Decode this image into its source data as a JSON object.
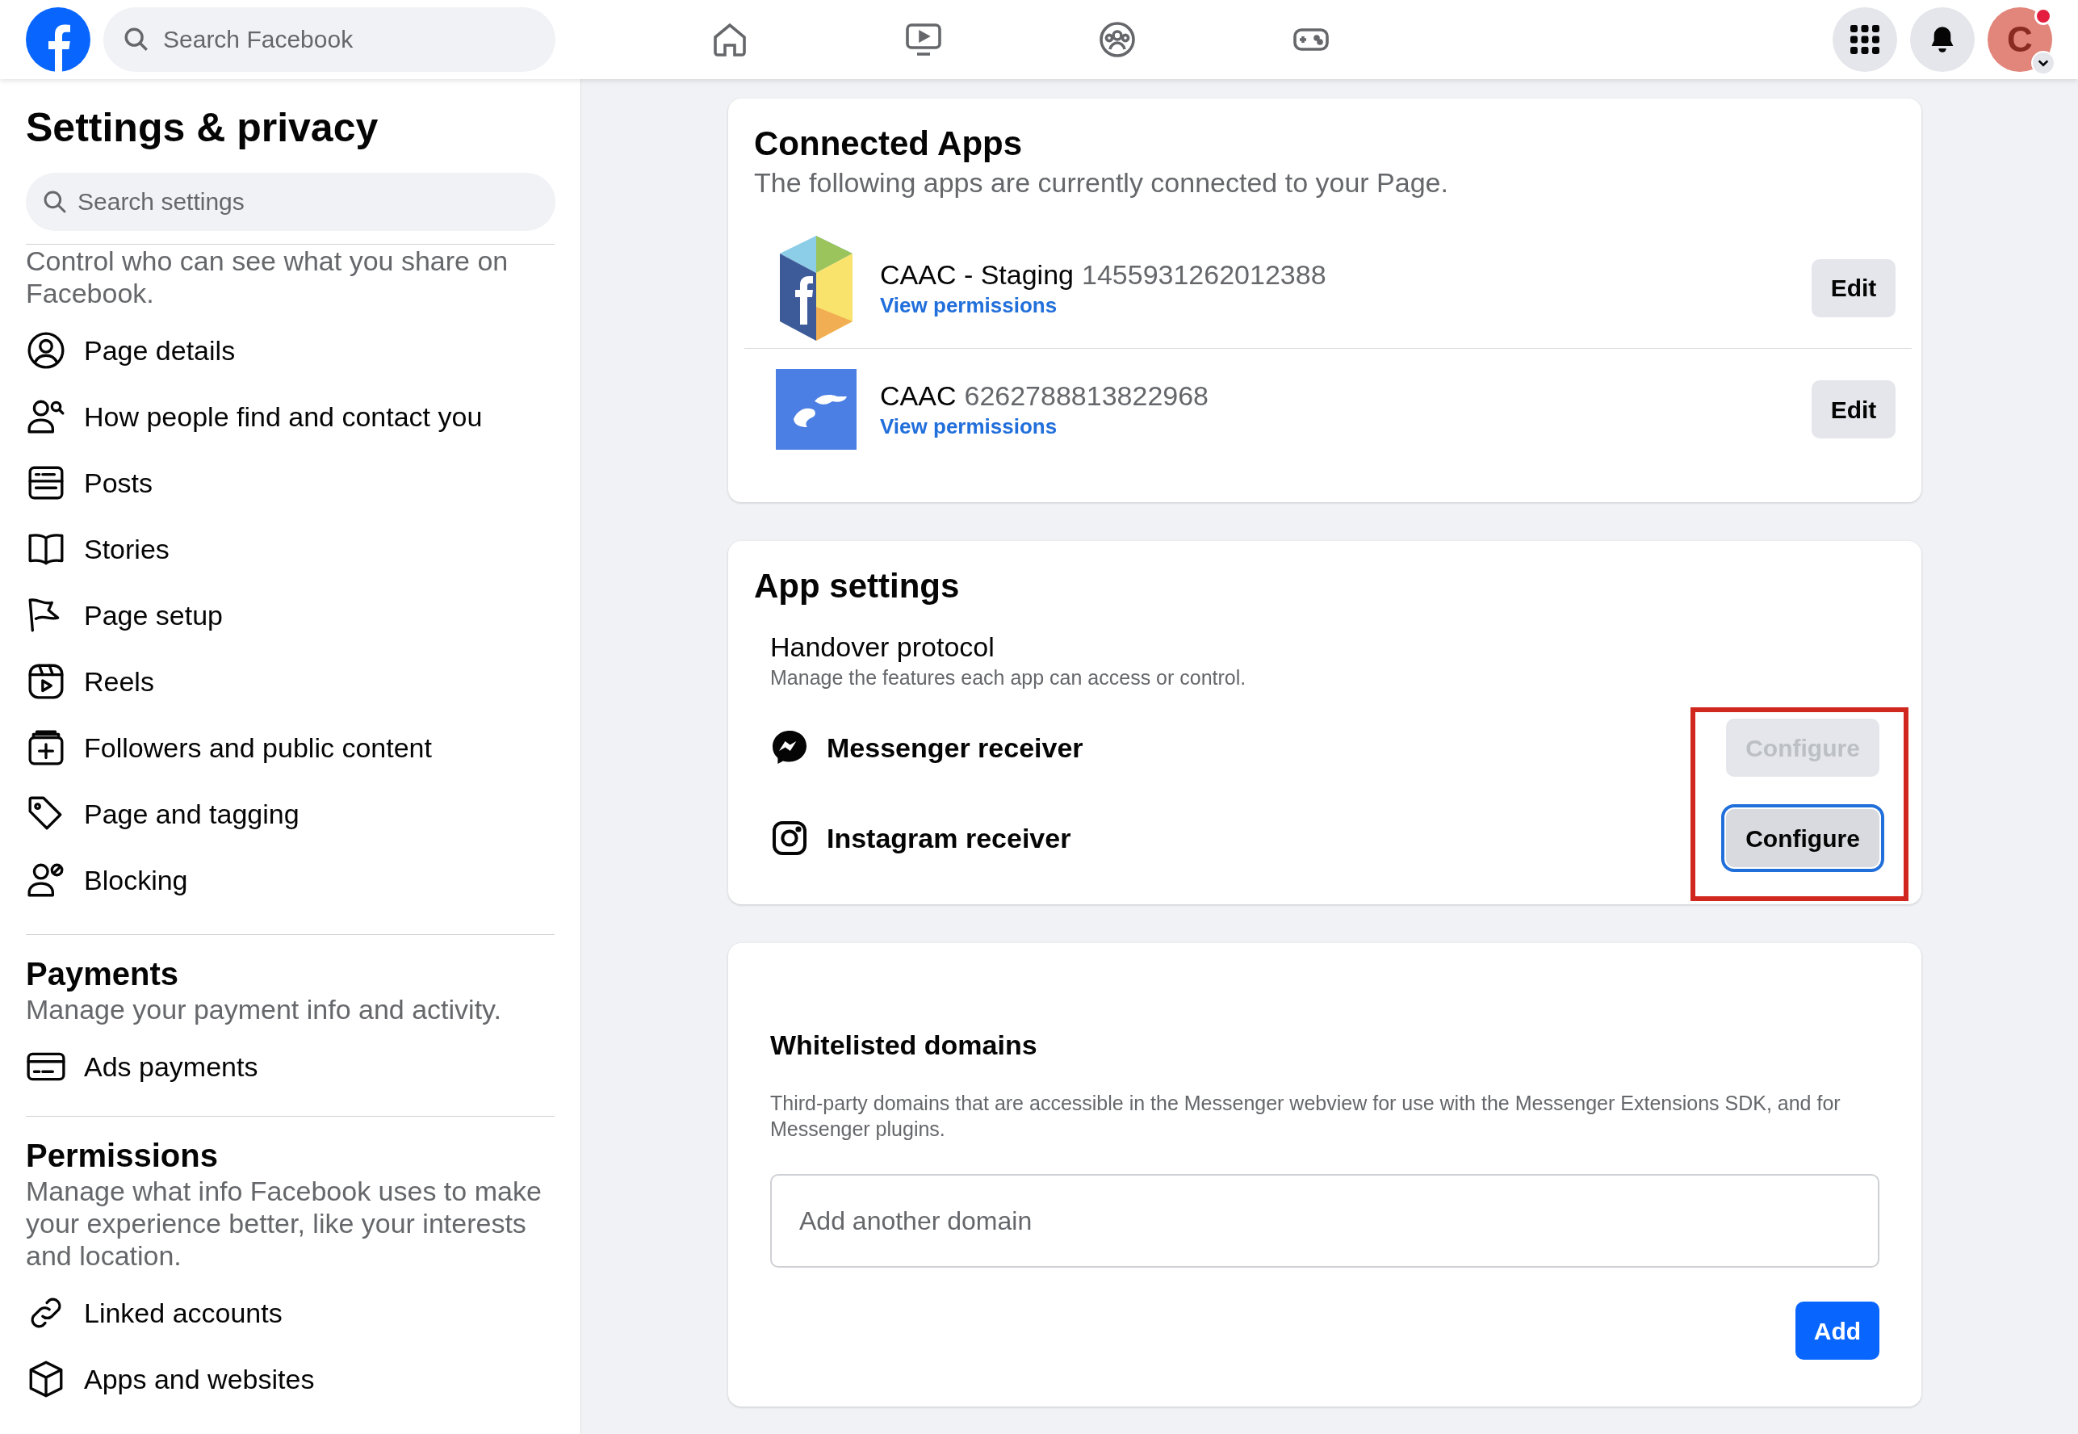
{
  "top_bar": {
    "search": {
      "placeholder": "Search Facebook"
    },
    "account": {
      "avatar_letter": "C",
      "has_notification": true
    }
  },
  "sidebar": {
    "title": "Settings & privacy",
    "search": {
      "placeholder": "Search settings"
    },
    "sections": [
      {
        "description": "Control who can see what you share on Facebook.",
        "items": [
          "Page details",
          "How people find and contact you",
          "Posts",
          "Stories",
          "Page setup",
          "Reels",
          "Followers and public content",
          "Page and tagging",
          "Blocking"
        ]
      },
      {
        "heading": "Payments",
        "description": "Manage your payment info and activity.",
        "items": [
          "Ads payments"
        ]
      },
      {
        "heading": "Permissions",
        "description": "Manage what info Facebook uses to make your experience better, like your interests and location.",
        "items": [
          "Linked accounts",
          "Apps and websites"
        ]
      }
    ]
  },
  "connected_apps": {
    "title": "Connected Apps",
    "subtitle": "The following apps are currently connected to your Page.",
    "apps": [
      {
        "name": "CAAC - Staging",
        "id": "1455931262012388",
        "link": "View permissions",
        "button": "Edit"
      },
      {
        "name": "CAAC",
        "id": "6262788813822968",
        "link": "View permissions",
        "button": "Edit"
      }
    ]
  },
  "app_settings": {
    "title": "App settings",
    "section_title": "Handover protocol",
    "section_description": "Manage the features each app can access or control.",
    "receivers": [
      {
        "label": "Messenger receiver",
        "button": "Configure",
        "disabled": true,
        "focused": false
      },
      {
        "label": "Instagram receiver",
        "button": "Configure",
        "disabled": false,
        "focused": true
      }
    ]
  },
  "whitelisted_domains": {
    "title": "Whitelisted domains",
    "description": "Third-party domains that are accessible in the Messenger webview for use with the Messenger Extensions SDK, and for Messenger plugins.",
    "input": {
      "placeholder": "Add another domain"
    },
    "button": "Add"
  }
}
